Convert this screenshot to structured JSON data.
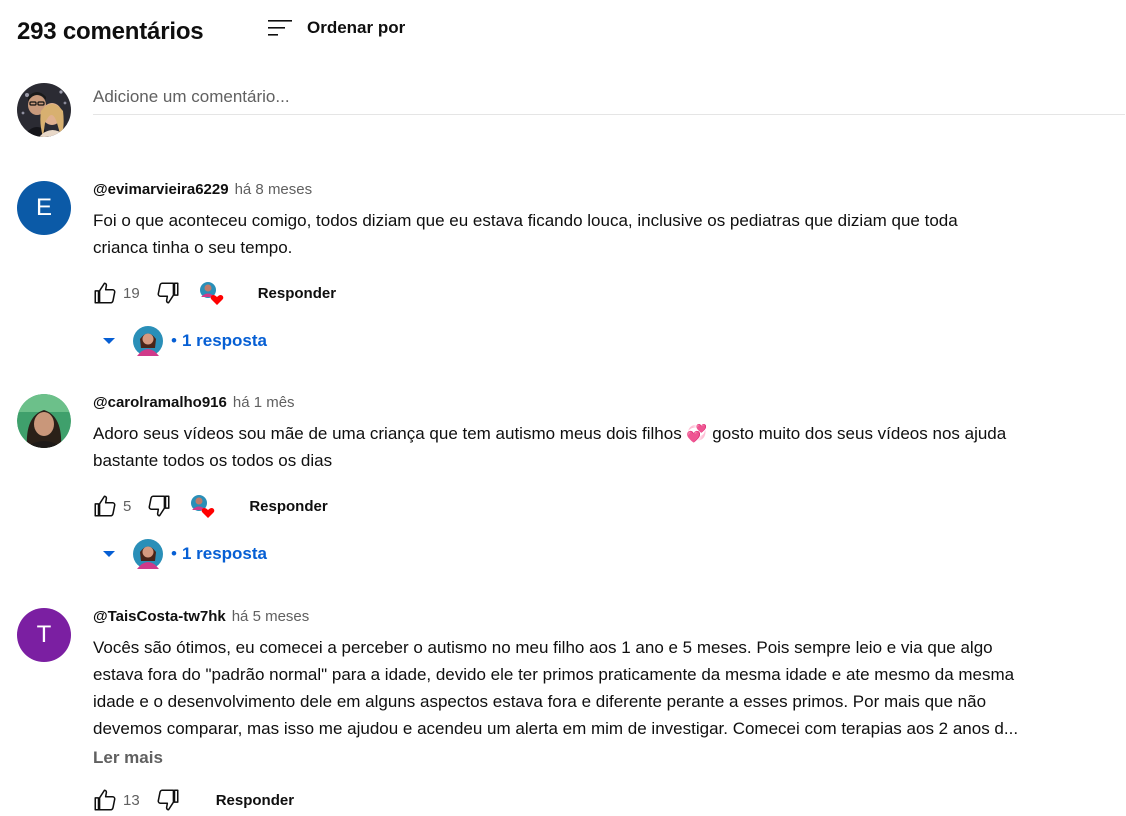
{
  "header": {
    "count": "293 comentários",
    "sort_label": "Ordenar por"
  },
  "add_comment": {
    "placeholder": "Adicione um comentário..."
  },
  "comments": [
    {
      "author": "@evimarvieira6229",
      "time": "há 8 meses",
      "avatar_letter": "E",
      "avatar_color": "#0b5aa7",
      "lines": [
        "Foi o que aconteceu comigo, todos diziam que eu estava ficando louca, inclusive os pediatras que diziam que toda",
        "crianca tinha o seu tempo."
      ],
      "likes": "19",
      "reply_label": "Responder",
      "replies_label": "1 resposta"
    },
    {
      "author": "@carolramalho916",
      "time": "há 1 mês",
      "lines": [
        "Adoro seus vídeos sou mãe de uma criança que tem autismo meus dois filhos 💞 gosto muito dos seus vídeos nos ajuda",
        "bastante todos os todos os dias"
      ],
      "likes": "5",
      "reply_label": "Responder",
      "replies_label": "1 resposta"
    },
    {
      "author": "@TaisCosta-tw7hk",
      "time": "há 5 meses",
      "avatar_letter": "T",
      "avatar_color": "#7b1fa2",
      "lines": [
        "Vocês são ótimos, eu comecei a perceber o autismo no meu filho aos 1 ano e 5 meses. Pois sempre leio e via que algo",
        "estava fora do \"padrão normal\" para a idade, devido ele ter primos praticamente da mesma idade e ate mesmo da mesma",
        "idade e o desenvolvimento dele em alguns aspectos estava fora e diferente perante a esses primos. Por mais que não",
        "devemos comparar, mas isso me ajudou e acendeu um alerta em mim de investigar. Comecei com terapias aos 2 anos d..."
      ],
      "read_more": "Ler mais",
      "likes": "13",
      "reply_label": "Responder"
    }
  ],
  "colors": {
    "link_blue": "#065fd4",
    "heart_red": "#ff0000",
    "secondary_text": "#606060"
  }
}
